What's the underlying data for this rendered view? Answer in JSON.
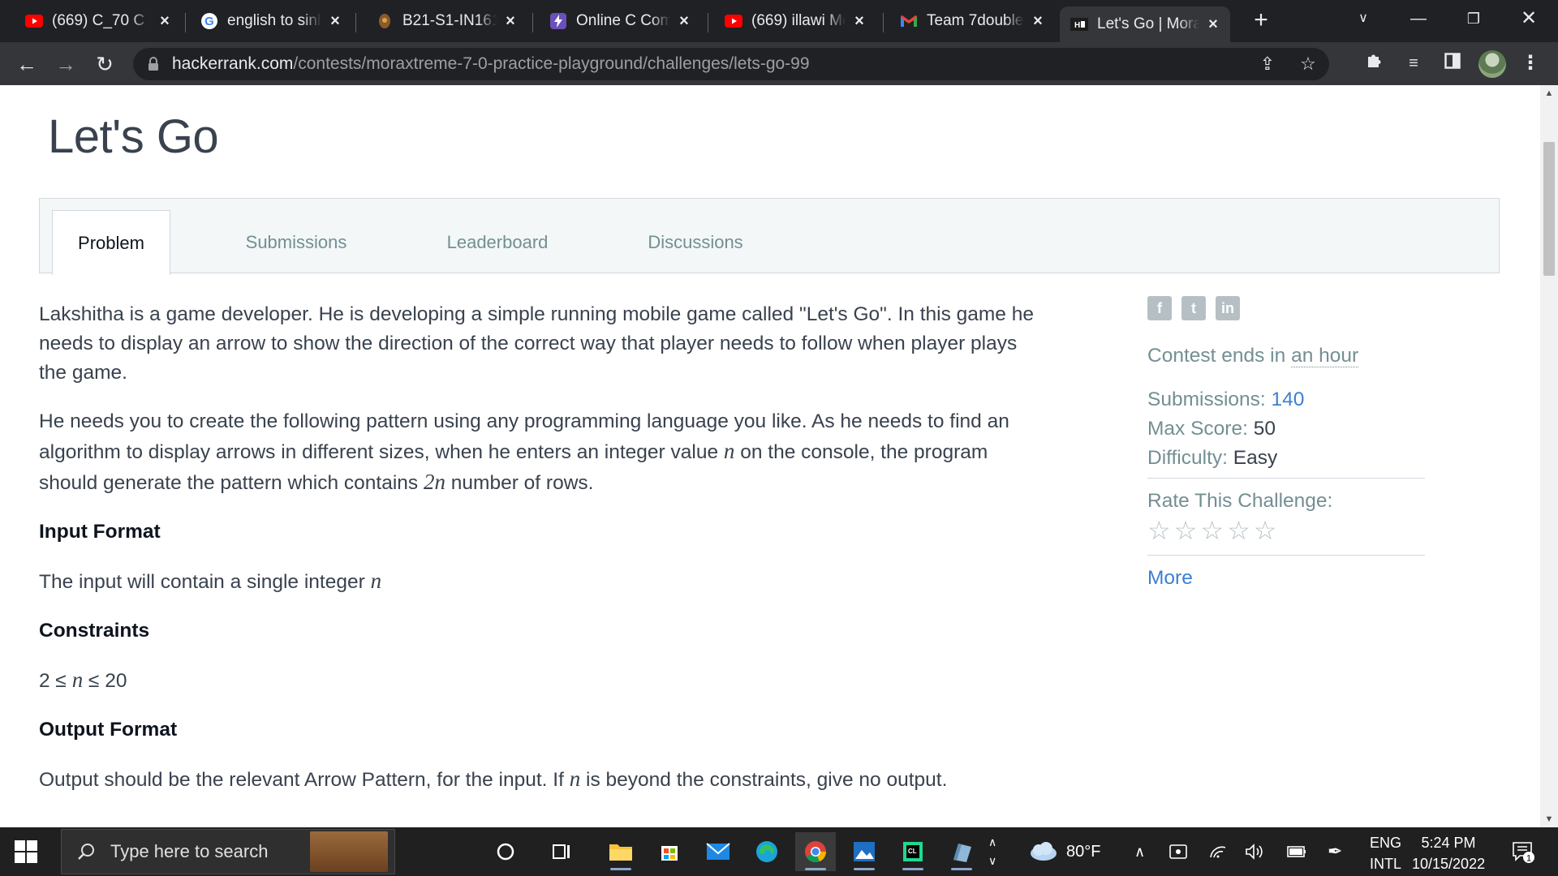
{
  "browser": {
    "tabs": [
      {
        "title": "(669) C_70 C Pr",
        "icon": "youtube-icon"
      },
      {
        "title": "english to sinh",
        "icon": "google-icon"
      },
      {
        "title": "B21-S1-IN1611",
        "icon": "university-icon"
      },
      {
        "title": "Online C Comp",
        "icon": "bolt-icon"
      },
      {
        "title": "(669) illawi Me",
        "icon": "youtube-icon"
      },
      {
        "title": "Team 7double",
        "icon": "gmail-icon"
      },
      {
        "title": "Let's Go | Mora",
        "icon": "hackerrank-icon",
        "active": true
      }
    ],
    "url_host": "hackerrank.com",
    "url_path": "/contests/moraxtreme-7-0-practice-playground/challenges/lets-go-99"
  },
  "page": {
    "title": "Let's Go",
    "tabs": [
      "Problem",
      "Submissions",
      "Leaderboard",
      "Discussions"
    ],
    "active_tab": "Problem"
  },
  "problem": {
    "intro": "Lakshitha is a game developer. He is developing a simple running mobile game called \"Let's Go\". In this game he needs to display an arrow to show the direction of the correct way that player needs to follow when player plays the game.",
    "task_part1": "He needs you to create the following pattern using any programming language you like. As he needs to find an algorithm to display arrows in different sizes, when he enters an integer value ",
    "task_var": "n",
    "task_part2": " on the console, the program should generate the pattern which contains ",
    "task_var2": "2n",
    "task_part3": " number of rows.",
    "input_heading": "Input Format",
    "input_text": "The input will contain a single integer ",
    "input_var": "n",
    "constraints_heading": "Constraints",
    "constraints_prefix": "2 ≤ ",
    "constraints_var": "n",
    "constraints_suffix": " ≤ 20",
    "output_heading": "Output Format",
    "output_part1": "Output should be the relevant Arrow Pattern, for the input. If ",
    "output_var": "n",
    "output_part2": " is beyond the constraints, give no output."
  },
  "sidebar": {
    "social": [
      "f",
      "t",
      "in"
    ],
    "contest_ends_label": "Contest ends in ",
    "contest_ends_value": "an hour",
    "submissions_label": "Submissions:",
    "submissions_value": "140",
    "max_score_label": "Max Score:",
    "max_score_value": "50",
    "difficulty_label": "Difficulty:",
    "difficulty_value": "Easy",
    "rate_label": "Rate This Challenge:",
    "stars": 5,
    "more_label": "More"
  },
  "taskbar": {
    "search_placeholder": "Type here to search",
    "weather": "80°F",
    "lang_top": "ENG",
    "lang_bottom": "INTL",
    "time": "5:24 PM",
    "date": "10/15/2022",
    "notification_count": "1"
  }
}
